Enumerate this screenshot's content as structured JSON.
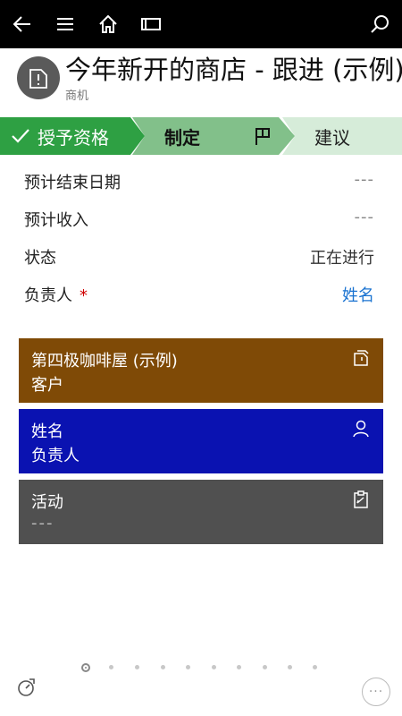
{
  "topbar": {
    "icons": [
      "back-arrow-icon",
      "hamburger-menu-icon",
      "home-icon",
      "window-icon",
      "search-icon"
    ]
  },
  "header": {
    "entity_icon": "opportunity-document-icon",
    "title": "今年新开的商店 - 跟进 (示例)",
    "entity_type": "商机"
  },
  "process": {
    "stages": [
      {
        "label": "授予资格",
        "status": "completed"
      },
      {
        "label": "制定",
        "status": "active"
      },
      {
        "label": "建议",
        "status": "upcoming"
      }
    ]
  },
  "fields": [
    {
      "label": "预计结束日期",
      "value": "---"
    },
    {
      "label": "预计收入",
      "value": "---"
    },
    {
      "label": "状态",
      "value": "正在进行"
    },
    {
      "label": "负责人",
      "value": "姓名",
      "required": "*"
    }
  ],
  "tiles": [
    {
      "title": "第四极咖啡屋 (示例)",
      "subtitle": "客户",
      "icon": "account-icon",
      "color": "#7f4a06"
    },
    {
      "title": "姓名",
      "subtitle": "负责人",
      "icon": "person-icon",
      "color": "#0a12b1"
    },
    {
      "title": "活动",
      "subtitle": "---",
      "icon": "clipboard-icon",
      "color": "#505050"
    }
  ],
  "pager": {
    "count": 10,
    "active_index": 0
  },
  "footer": {
    "more_label": "···"
  },
  "colors": {
    "accent_green": "#2ea043",
    "link_blue": "#1a73d1",
    "required_red": "#d00000"
  }
}
